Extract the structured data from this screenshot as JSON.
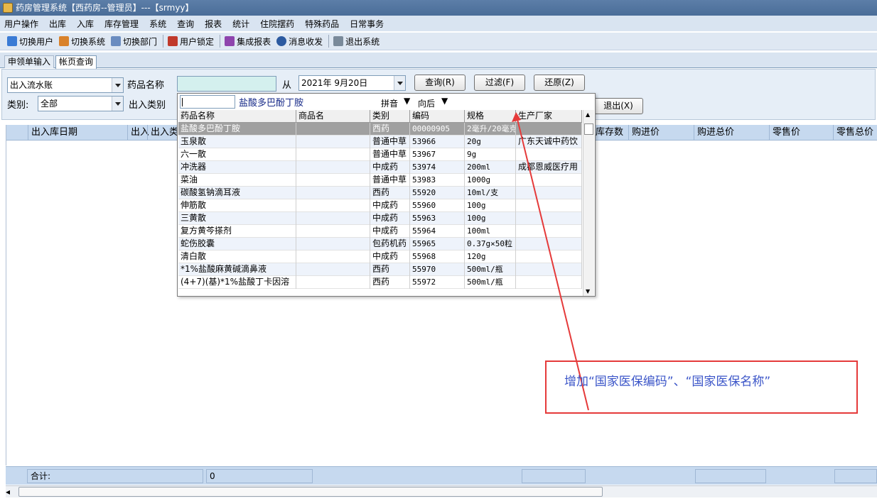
{
  "window": {
    "title": "药房管理系统【西药房--管理员】---【srmyy】"
  },
  "menu": [
    "用户操作",
    "出库",
    "入库",
    "库存管理",
    "系统",
    "查询",
    "报表",
    "统计",
    "住院摆药",
    "特殊药品",
    "日常事务"
  ],
  "toolbar": [
    {
      "label": "切换用户",
      "icon": "users-icon",
      "color": "#3a7bd5"
    },
    {
      "label": "切换系统",
      "icon": "switch-system-icon",
      "color": "#d9822b"
    },
    {
      "label": "切换部门",
      "icon": "department-icon",
      "color": "#6a8cc0"
    },
    {
      "label": "用户锁定",
      "icon": "user-lock-icon",
      "color": "#c0392b"
    },
    {
      "label": "集成报表",
      "icon": "report-icon",
      "color": "#8e44ad"
    },
    {
      "label": "消息收发",
      "icon": "info-icon",
      "color": "#2c5aa0"
    },
    {
      "label": "退出系统",
      "icon": "exit-icon",
      "color": "#7a8a9a"
    }
  ],
  "tabs": [
    {
      "label": "申领单输入",
      "active": false
    },
    {
      "label": "帐页查询",
      "active": true
    }
  ],
  "filters": {
    "account_type": "出入流水账",
    "drug_name_label": "药品名称",
    "from_label": "从",
    "date_value": "2021年 9月20日",
    "category_label": "类别:",
    "category_value": "全部",
    "io_type_label": "出入类别",
    "query_button": "查询(R)",
    "filter_button": "过滤(F)",
    "restore_button": "还原(Z)",
    "exit_button": "退出(X)"
  },
  "grid": {
    "headers": [
      {
        "label": "出入库日期"
      },
      {
        "label": "出入"
      },
      {
        "label": "出入类"
      },
      {
        "label": "库存数"
      },
      {
        "label": "购进价"
      },
      {
        "label": "购进总价"
      },
      {
        "label": "零售价"
      },
      {
        "label": "零售总价"
      }
    ],
    "total_label": "合计:",
    "total_value": "0"
  },
  "dropdown": {
    "selected_name": "盐酸多巴酚丁胺",
    "pinyin_label": "拼音",
    "direction_label": "向后",
    "columns": [
      "药品名称",
      "商品名",
      "类别",
      "编码",
      "规格",
      "生产厂家"
    ],
    "rows": [
      {
        "name": "盐酸多巴酚丁胺",
        "trade": "",
        "cat": "西药",
        "code": "00000905",
        "spec": "2毫升/20毫克",
        "maker": "",
        "selected": true
      },
      {
        "name": "玉泉散",
        "trade": "",
        "cat": "普通中草",
        "code": "53966",
        "spec": "20g",
        "maker": "广东天诚中药饮"
      },
      {
        "name": "六一散",
        "trade": "",
        "cat": "普通中草",
        "code": "53967",
        "spec": "9g",
        "maker": ""
      },
      {
        "name": "冲洗器",
        "trade": "",
        "cat": "中成药",
        "code": "53974",
        "spec": "200ml",
        "maker": "成都恩威医疗用"
      },
      {
        "name": "菜油",
        "trade": "",
        "cat": "普通中草",
        "code": "53983",
        "spec": "1000g",
        "maker": ""
      },
      {
        "name": "碳酸氢钠滴耳液",
        "trade": "",
        "cat": "西药",
        "code": "55920",
        "spec": "10ml/支",
        "maker": ""
      },
      {
        "name": "伸筋散",
        "trade": "",
        "cat": "中成药",
        "code": "55960",
        "spec": "100g",
        "maker": ""
      },
      {
        "name": "三黄散",
        "trade": "",
        "cat": "中成药",
        "code": "55963",
        "spec": "100g",
        "maker": ""
      },
      {
        "name": "复方黄芩搽剂",
        "trade": "",
        "cat": "中成药",
        "code": "55964",
        "spec": "100ml",
        "maker": ""
      },
      {
        "name": "蛇伤胶囊",
        "trade": "",
        "cat": "包药机药",
        "code": "55965",
        "spec": "0.37g×50粒",
        "maker": ""
      },
      {
        "name": "清白散",
        "trade": "",
        "cat": "中成药",
        "code": "55968",
        "spec": "120g",
        "maker": ""
      },
      {
        "name": "*1%盐酸麻黄碱滴鼻液",
        "trade": "",
        "cat": "西药",
        "code": "55970",
        "spec": "500ml/瓶",
        "maker": ""
      },
      {
        "name": "(4+7)(基)*1%盐酸丁卡因溶",
        "trade": "",
        "cat": "西药",
        "code": "55972",
        "spec": "500ml/瓶",
        "maker": ""
      }
    ]
  },
  "annotation": {
    "text": "增加“国家医保编码”、“国家医保名称”",
    "color": "#e53a3a"
  }
}
